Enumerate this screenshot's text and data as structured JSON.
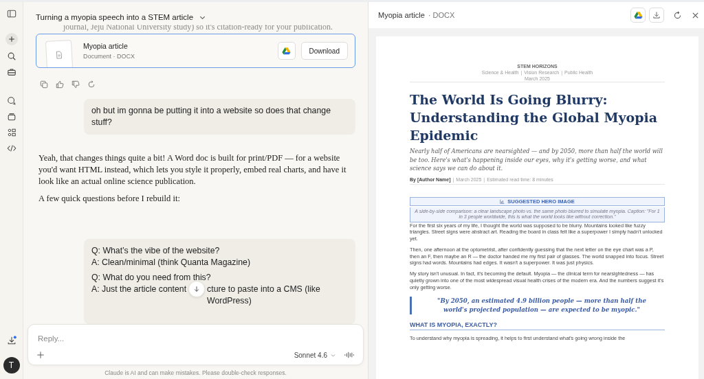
{
  "sidebar": {
    "avatar_letter": "T",
    "download_badge": true
  },
  "chat": {
    "title": "Turning a myopia speech into a STEM article",
    "previous_text_tail": "journal, Jeju National University study) so it's citation-ready for your publication.",
    "file_card": {
      "name": "Myopia article",
      "meta": "Document · DOCX",
      "button": "Download",
      "selected": true
    },
    "user_message": "oh but im gonna be putting it into a website so does that change stuff?",
    "assistant_paragraphs": [
      "Yeah, that changes things quite a bit! A Word doc is built for print/PDF — for a website you'd want HTML instead, which lets you style it properly, embed real charts, and have it look like an actual online science publication.",
      "A few quick questions before I rebuild it:"
    ],
    "qa": [
      {
        "question": "Q: What’s the vibe of the website?",
        "answer_parts": [
          "A: Clean/minimal (think Quanta Magazine)"
        ]
      },
      {
        "question": "Q: What do you need from this?",
        "answer_parts": [
          "A: Just the article content",
          "cture to paste into a CMS (like WordPress)"
        ]
      }
    ],
    "composer": {
      "placeholder": "Reply...",
      "model": "Sonnet 4.6"
    },
    "disclaimer": "Claude is AI and can make mistakes. Please double-check responses."
  },
  "artifact": {
    "title": "Myopia article",
    "type": "· DOCX",
    "document": {
      "masthead": "STEM HORIZONS",
      "separator": "|",
      "sections": [
        "Science & Health",
        "Vision Research",
        "Public Health"
      ],
      "date": "March 2025",
      "headline": "The World Is Going Blurry: Understanding the Global Myopia Epidemic",
      "dek": "Nearly half of Americans are nearsighted — and by 2050, more than half the world will be too. Here's what's happening inside our eyes, why it's getting worse, and what science says we can do about it.",
      "byline": [
        "By [Author Name]",
        "March 2025",
        "Estimated read time: 8 minutes"
      ],
      "hero_box": {
        "title": "SUGGESTED HERO IMAGE",
        "description": "A side-by-side comparison: a clear landscape photo vs. the same photo blurred to simulate myopia. Caption: \"For 1 in 3 people worldwide, this is what the world looks like without correction.\""
      },
      "paragraphs": [
        "For the first six years of my life, I thought the world was supposed to be blurry. Mountains looked like fuzzy triangles. Street signs were abstract art. Reading the board in class felt like a superpower I simply hadn't unlocked yet.",
        "Then, one afternoon at the optometrist, after confidently guessing that the next letter on the eye chart was a P, then an F, then maybe an R — the doctor handed me my first pair of glasses. The world snapped into focus. Street signs had words. Mountains had edges. It wasn't a superpower. It was just physics.",
        "My story isn't unusual. In fact, it's becoming the default. Myopia — the clinical term for nearsightedness — has quietly grown into one of the most widespread visual health crises of the modern era. And the numbers suggest it's only getting worse."
      ],
      "pull_quote": "\"By 2050, an estimated 4.9 billion people — more than half the world's projected population — are expected to be myopic.\"",
      "section_heading": "WHAT IS MYOPIA, EXACTLY?",
      "last_paragraph": "To understand why myopia is spreading, it helps to first understand what's going wrong inside the"
    }
  }
}
